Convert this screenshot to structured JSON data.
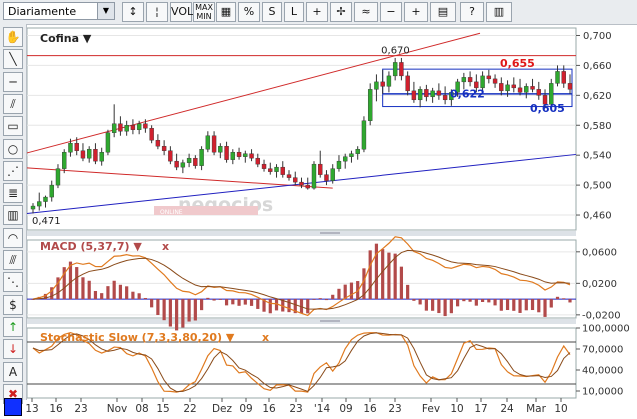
{
  "toolbar": {
    "period_select": "Diariamente",
    "buttons": [
      {
        "name": "bars-type-button",
        "label": "↕"
      },
      {
        "name": "candles-type-button",
        "label": "¦"
      },
      {
        "name": "vol-button",
        "label": "VOL"
      },
      {
        "name": "min-max-button",
        "label": "MAX MIN"
      },
      {
        "name": "grid-button",
        "label": "▦"
      },
      {
        "name": "percent-button",
        "label": "%"
      },
      {
        "name": "semilog-button",
        "label": "S"
      },
      {
        "name": "linear-button",
        "label": "L"
      },
      {
        "name": "crosshair-button",
        "label": "+"
      },
      {
        "name": "crosshair-move-button",
        "label": "✢"
      },
      {
        "name": "wave-button",
        "label": "≈"
      },
      {
        "name": "zoom-out-button",
        "label": "−"
      },
      {
        "name": "zoom-in-button",
        "label": "+"
      },
      {
        "name": "print-button",
        "label": "▤"
      },
      {
        "name": "help-button",
        "label": "?"
      },
      {
        "name": "book-button",
        "label": "▥"
      }
    ]
  },
  "sidebar": {
    "tools": [
      {
        "name": "hand-tool",
        "glyph": "✋"
      },
      {
        "name": "trendline-tool",
        "glyph": "╲"
      },
      {
        "name": "line-tool",
        "glyph": "─"
      },
      {
        "name": "parallel-tool",
        "glyph": "⫽"
      },
      {
        "name": "rectangle-tool",
        "glyph": "▭"
      },
      {
        "name": "circle-tool",
        "glyph": "○"
      },
      {
        "name": "fan-tool",
        "glyph": "⋰"
      },
      {
        "name": "fibonacci-tool",
        "glyph": "≣"
      },
      {
        "name": "retracement-tool",
        "glyph": "▥"
      },
      {
        "name": "arc-tool",
        "glyph": "◠"
      },
      {
        "name": "channel-tool",
        "glyph": "⫻"
      },
      {
        "name": "speed-lines-tool",
        "glyph": "⋱"
      },
      {
        "name": "dollar-tool",
        "glyph": "$"
      },
      {
        "name": "arrow-up-tool",
        "glyph": "↑"
      },
      {
        "name": "arrow-down-tool",
        "glyph": "↓"
      },
      {
        "name": "text-tool",
        "glyph": "A"
      },
      {
        "name": "delete-tool",
        "glyph": "✖"
      }
    ]
  },
  "colors": {
    "up": "#2fa82f",
    "down": "#d0202e",
    "red_line": "#d02a2a",
    "blue_line": "#2020c0",
    "orange": "#e07a1f",
    "macd_hist": "#b24a4a",
    "level_blue": "#1530c0",
    "level_red": "#e01818",
    "accent_box": "#1030ff"
  },
  "chart_data": {
    "type": "candlestick",
    "price": {
      "title": "Cofina ▼",
      "ylim": [
        0.44,
        0.71
      ],
      "yticks": [
        "0,460",
        "0,500",
        "0,540",
        "0,580",
        "0,620",
        "0,660",
        "0,700"
      ],
      "annotations": [
        "0,670",
        "0,655",
        "0,622",
        "0,605",
        "0,471"
      ],
      "watermark": "negocios",
      "watermark_sub": "ONLINE",
      "candles": [
        {
          "o": 0.468,
          "h": 0.476,
          "l": 0.462,
          "c": 0.472
        },
        {
          "o": 0.472,
          "h": 0.49,
          "l": 0.466,
          "c": 0.478
        },
        {
          "o": 0.478,
          "h": 0.486,
          "l": 0.47,
          "c": 0.484
        },
        {
          "o": 0.484,
          "h": 0.506,
          "l": 0.478,
          "c": 0.5
        },
        {
          "o": 0.5,
          "h": 0.528,
          "l": 0.496,
          "c": 0.522
        },
        {
          "o": 0.522,
          "h": 0.548,
          "l": 0.516,
          "c": 0.544
        },
        {
          "o": 0.544,
          "h": 0.562,
          "l": 0.538,
          "c": 0.556
        },
        {
          "o": 0.556,
          "h": 0.564,
          "l": 0.54,
          "c": 0.546
        },
        {
          "o": 0.546,
          "h": 0.556,
          "l": 0.532,
          "c": 0.536
        },
        {
          "o": 0.536,
          "h": 0.552,
          "l": 0.53,
          "c": 0.548
        },
        {
          "o": 0.548,
          "h": 0.556,
          "l": 0.528,
          "c": 0.532
        },
        {
          "o": 0.532,
          "h": 0.55,
          "l": 0.526,
          "c": 0.544
        },
        {
          "o": 0.544,
          "h": 0.574,
          "l": 0.54,
          "c": 0.57
        },
        {
          "o": 0.57,
          "h": 0.608,
          "l": 0.564,
          "c": 0.582
        },
        {
          "o": 0.582,
          "h": 0.592,
          "l": 0.566,
          "c": 0.572
        },
        {
          "o": 0.572,
          "h": 0.586,
          "l": 0.566,
          "c": 0.58
        },
        {
          "o": 0.58,
          "h": 0.588,
          "l": 0.568,
          "c": 0.574
        },
        {
          "o": 0.574,
          "h": 0.586,
          "l": 0.568,
          "c": 0.582
        },
        {
          "o": 0.582,
          "h": 0.588,
          "l": 0.57,
          "c": 0.576
        },
        {
          "o": 0.576,
          "h": 0.58,
          "l": 0.556,
          "c": 0.56
        },
        {
          "o": 0.56,
          "h": 0.568,
          "l": 0.548,
          "c": 0.552
        },
        {
          "o": 0.552,
          "h": 0.56,
          "l": 0.54,
          "c": 0.546
        },
        {
          "o": 0.546,
          "h": 0.552,
          "l": 0.528,
          "c": 0.532
        },
        {
          "o": 0.532,
          "h": 0.542,
          "l": 0.52,
          "c": 0.524
        },
        {
          "o": 0.524,
          "h": 0.534,
          "l": 0.516,
          "c": 0.53
        },
        {
          "o": 0.53,
          "h": 0.542,
          "l": 0.524,
          "c": 0.536
        },
        {
          "o": 0.536,
          "h": 0.54,
          "l": 0.522,
          "c": 0.526
        },
        {
          "o": 0.526,
          "h": 0.552,
          "l": 0.52,
          "c": 0.548
        },
        {
          "o": 0.548,
          "h": 0.572,
          "l": 0.544,
          "c": 0.566
        },
        {
          "o": 0.566,
          "h": 0.572,
          "l": 0.54,
          "c": 0.544
        },
        {
          "o": 0.544,
          "h": 0.556,
          "l": 0.536,
          "c": 0.552
        },
        {
          "o": 0.552,
          "h": 0.558,
          "l": 0.53,
          "c": 0.534
        },
        {
          "o": 0.534,
          "h": 0.548,
          "l": 0.528,
          "c": 0.544
        },
        {
          "o": 0.544,
          "h": 0.55,
          "l": 0.534,
          "c": 0.538
        },
        {
          "o": 0.538,
          "h": 0.546,
          "l": 0.53,
          "c": 0.542
        },
        {
          "o": 0.542,
          "h": 0.548,
          "l": 0.532,
          "c": 0.536
        },
        {
          "o": 0.536,
          "h": 0.542,
          "l": 0.524,
          "c": 0.528
        },
        {
          "o": 0.528,
          "h": 0.534,
          "l": 0.518,
          "c": 0.522
        },
        {
          "o": 0.522,
          "h": 0.53,
          "l": 0.514,
          "c": 0.518
        },
        {
          "o": 0.518,
          "h": 0.528,
          "l": 0.51,
          "c": 0.524
        },
        {
          "o": 0.524,
          "h": 0.532,
          "l": 0.51,
          "c": 0.514
        },
        {
          "o": 0.514,
          "h": 0.52,
          "l": 0.506,
          "c": 0.51
        },
        {
          "o": 0.51,
          "h": 0.518,
          "l": 0.5,
          "c": 0.504
        },
        {
          "o": 0.504,
          "h": 0.51,
          "l": 0.496,
          "c": 0.5
        },
        {
          "o": 0.5,
          "h": 0.51,
          "l": 0.494,
          "c": 0.496
        },
        {
          "o": 0.496,
          "h": 0.532,
          "l": 0.494,
          "c": 0.528
        },
        {
          "o": 0.528,
          "h": 0.546,
          "l": 0.51,
          "c": 0.514
        },
        {
          "o": 0.514,
          "h": 0.52,
          "l": 0.5,
          "c": 0.506
        },
        {
          "o": 0.506,
          "h": 0.528,
          "l": 0.502,
          "c": 0.522
        },
        {
          "o": 0.522,
          "h": 0.54,
          "l": 0.518,
          "c": 0.532
        },
        {
          "o": 0.532,
          "h": 0.542,
          "l": 0.522,
          "c": 0.538
        },
        {
          "o": 0.538,
          "h": 0.546,
          "l": 0.53,
          "c": 0.542
        },
        {
          "o": 0.542,
          "h": 0.552,
          "l": 0.534,
          "c": 0.548
        },
        {
          "o": 0.548,
          "h": 0.592,
          "l": 0.544,
          "c": 0.586
        },
        {
          "o": 0.586,
          "h": 0.636,
          "l": 0.58,
          "c": 0.628
        },
        {
          "o": 0.628,
          "h": 0.648,
          "l": 0.612,
          "c": 0.638
        },
        {
          "o": 0.638,
          "h": 0.654,
          "l": 0.622,
          "c": 0.632
        },
        {
          "o": 0.632,
          "h": 0.652,
          "l": 0.624,
          "c": 0.646
        },
        {
          "o": 0.646,
          "h": 0.67,
          "l": 0.64,
          "c": 0.664
        },
        {
          "o": 0.664,
          "h": 0.67,
          "l": 0.64,
          "c": 0.646
        },
        {
          "o": 0.646,
          "h": 0.652,
          "l": 0.62,
          "c": 0.626
        },
        {
          "o": 0.626,
          "h": 0.638,
          "l": 0.61,
          "c": 0.614
        },
        {
          "o": 0.614,
          "h": 0.632,
          "l": 0.604,
          "c": 0.628
        },
        {
          "o": 0.628,
          "h": 0.634,
          "l": 0.612,
          "c": 0.618
        },
        {
          "o": 0.618,
          "h": 0.63,
          "l": 0.61,
          "c": 0.626
        },
        {
          "o": 0.626,
          "h": 0.636,
          "l": 0.614,
          "c": 0.62
        },
        {
          "o": 0.62,
          "h": 0.632,
          "l": 0.608,
          "c": 0.614
        },
        {
          "o": 0.614,
          "h": 0.628,
          "l": 0.606,
          "c": 0.624
        },
        {
          "o": 0.624,
          "h": 0.642,
          "l": 0.618,
          "c": 0.638
        },
        {
          "o": 0.638,
          "h": 0.65,
          "l": 0.628,
          "c": 0.644
        },
        {
          "o": 0.644,
          "h": 0.652,
          "l": 0.632,
          "c": 0.638
        },
        {
          "o": 0.638,
          "h": 0.648,
          "l": 0.624,
          "c": 0.63
        },
        {
          "o": 0.63,
          "h": 0.652,
          "l": 0.626,
          "c": 0.646
        },
        {
          "o": 0.646,
          "h": 0.654,
          "l": 0.636,
          "c": 0.642
        },
        {
          "o": 0.642,
          "h": 0.648,
          "l": 0.63,
          "c": 0.636
        },
        {
          "o": 0.636,
          "h": 0.644,
          "l": 0.62,
          "c": 0.626
        },
        {
          "o": 0.626,
          "h": 0.64,
          "l": 0.618,
          "c": 0.634
        },
        {
          "o": 0.634,
          "h": 0.644,
          "l": 0.624,
          "c": 0.63
        },
        {
          "o": 0.63,
          "h": 0.642,
          "l": 0.62,
          "c": 0.624
        },
        {
          "o": 0.624,
          "h": 0.636,
          "l": 0.616,
          "c": 0.632
        },
        {
          "o": 0.632,
          "h": 0.642,
          "l": 0.624,
          "c": 0.628
        },
        {
          "o": 0.628,
          "h": 0.638,
          "l": 0.614,
          "c": 0.62
        },
        {
          "o": 0.62,
          "h": 0.628,
          "l": 0.604,
          "c": 0.608
        },
        {
          "o": 0.608,
          "h": 0.642,
          "l": 0.606,
          "c": 0.636
        },
        {
          "o": 0.636,
          "h": 0.66,
          "l": 0.632,
          "c": 0.652
        },
        {
          "o": 0.652,
          "h": 0.66,
          "l": 0.63,
          "c": 0.636
        },
        {
          "o": 0.636,
          "h": 0.648,
          "l": 0.622,
          "c": 0.628
        }
      ]
    },
    "macd": {
      "title": "MACD (5,37,7) ▼",
      "close_icon": "x",
      "ylim": [
        -0.024,
        0.075
      ],
      "yticks": [
        "-0,0200",
        "0,0200",
        "0,0600"
      ]
    },
    "stochastic": {
      "title": "Stochastic Slow (7,3,3,80,20) ▼",
      "close_icon": "x",
      "ylim": [
        0,
        100
      ],
      "yticks": [
        "10,0000",
        "40,0000",
        "70,0000",
        "100,0000"
      ],
      "levels": [
        20,
        80
      ]
    },
    "x_labels": [
      "13",
      "16",
      "23",
      "Nov",
      "08",
      "15",
      "22",
      "Dez",
      "09",
      "16",
      "23",
      "'14",
      "09",
      "16",
      "23",
      "Fev",
      "10",
      "17",
      "24",
      "Mar",
      "10"
    ]
  }
}
